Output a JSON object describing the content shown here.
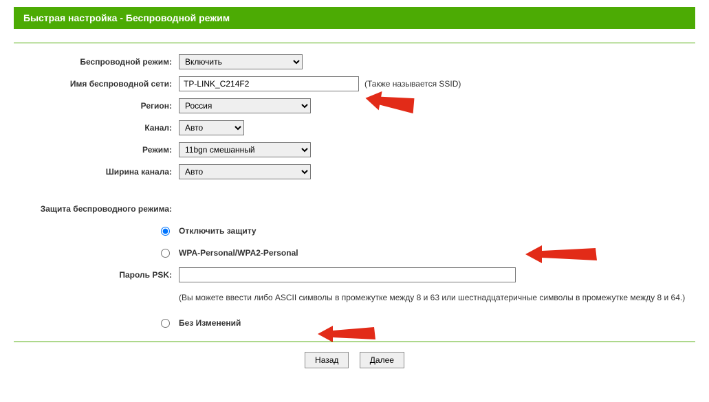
{
  "header": {
    "title": "Быстрая настройка - Беспроводной режим"
  },
  "form": {
    "wireless_label": "Беспроводной режим:",
    "wireless_value": "Включить",
    "ssid_label": "Имя беспроводной сети:",
    "ssid_value": "TP-LINK_C214F2",
    "ssid_hint": "(Также называется SSID)",
    "region_label": "Регион:",
    "region_value": "Россия",
    "channel_label": "Канал:",
    "channel_value": "Авто",
    "mode_label": "Режим:",
    "mode_value": "11bgn смешанный",
    "chwidth_label": "Ширина канала:",
    "chwidth_value": "Авто"
  },
  "security": {
    "heading": "Защита беспроводного режима:",
    "opt_disable": "Отключить защиту",
    "opt_wpa": "WPA-Personal/WPA2-Personal",
    "psk_label": "Пароль PSK:",
    "psk_value": "",
    "psk_hint": "(Вы можете ввести либо ASCII символы в промежутке между 8 и 63 или шестнадцатеричные символы в промежутке между 8 и 64.)",
    "opt_nochange": "Без Изменений"
  },
  "buttons": {
    "back": "Назад",
    "next": "Далее"
  }
}
